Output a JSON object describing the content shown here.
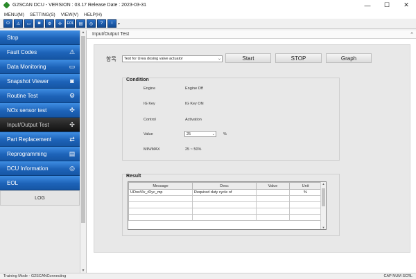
{
  "window": {
    "title": "G2SCAN DCU - VERSION : 03.17 Release Date : 2023-03-31",
    "min": "—",
    "max": "☐",
    "close": "✕"
  },
  "menu": [
    "MENU(M)",
    "SETTING(S)",
    "VIEW(V)",
    "HELP(H)"
  ],
  "toolbar": {
    "icons": [
      "power-icon",
      "warning-icon",
      "monitor-icon",
      "camera-icon",
      "routine-icon",
      "io-icon",
      "eol-icon",
      "reprogram-icon",
      "dcu-info-icon",
      "help-icon",
      "info-icon"
    ],
    "eol": "EOL"
  },
  "sidebar": {
    "items": [
      {
        "label": "Stop",
        "icon": "stop-icon"
      },
      {
        "label": "Fault Codes",
        "icon": "warning-icon"
      },
      {
        "label": "Data Monitoring",
        "icon": "monitor-icon"
      },
      {
        "label": "Snapshot Viewer",
        "icon": "camera-icon"
      },
      {
        "label": "Routine Test",
        "icon": "routine-icon"
      },
      {
        "label": "NOx sensor test",
        "icon": "sensor-icon"
      },
      {
        "label": "Input/Output Test",
        "icon": "io-icon",
        "active": true
      },
      {
        "label": "Part Replacement",
        "icon": "part-icon"
      },
      {
        "label": "Reprogramming",
        "icon": "reprogram-icon"
      },
      {
        "label": "DCU Information",
        "icon": "dcu-icon"
      },
      {
        "label": "EOL",
        "icon": ""
      }
    ],
    "log": "LOG"
  },
  "page": {
    "title": "Input/Output Test",
    "item_label": "항목",
    "item_selected": "Test for Urea dosing valve actuator",
    "buttons": {
      "start": "Start",
      "stop": "STOP",
      "graph": "Graph"
    }
  },
  "condition": {
    "title": "Condition",
    "rows": [
      {
        "label": "Engine",
        "value": "Engine Off"
      },
      {
        "label": "IG Key",
        "value": "IG Key ON"
      },
      {
        "label": "Control",
        "value": "Activation"
      },
      {
        "label": "Value",
        "value": "25",
        "unit": "%"
      },
      {
        "label": "MIN/MAX",
        "value": "25 ~ 50%"
      }
    ]
  },
  "result": {
    "title": "Result",
    "columns": [
      "Message",
      "Desc",
      "Value",
      "Unit"
    ],
    "rows": [
      [
        "UDosVlv_rDyc_mp",
        "Required duty cycle of",
        "",
        "%"
      ],
      [
        "",
        "",
        "",
        ""
      ],
      [
        "",
        "",
        "",
        ""
      ],
      [
        "",
        "",
        "",
        ""
      ],
      [
        "",
        "",
        "",
        ""
      ]
    ]
  },
  "status": {
    "left": "Training Mode - G2SCANConnecting",
    "right": "CAP NUM SCRL"
  }
}
